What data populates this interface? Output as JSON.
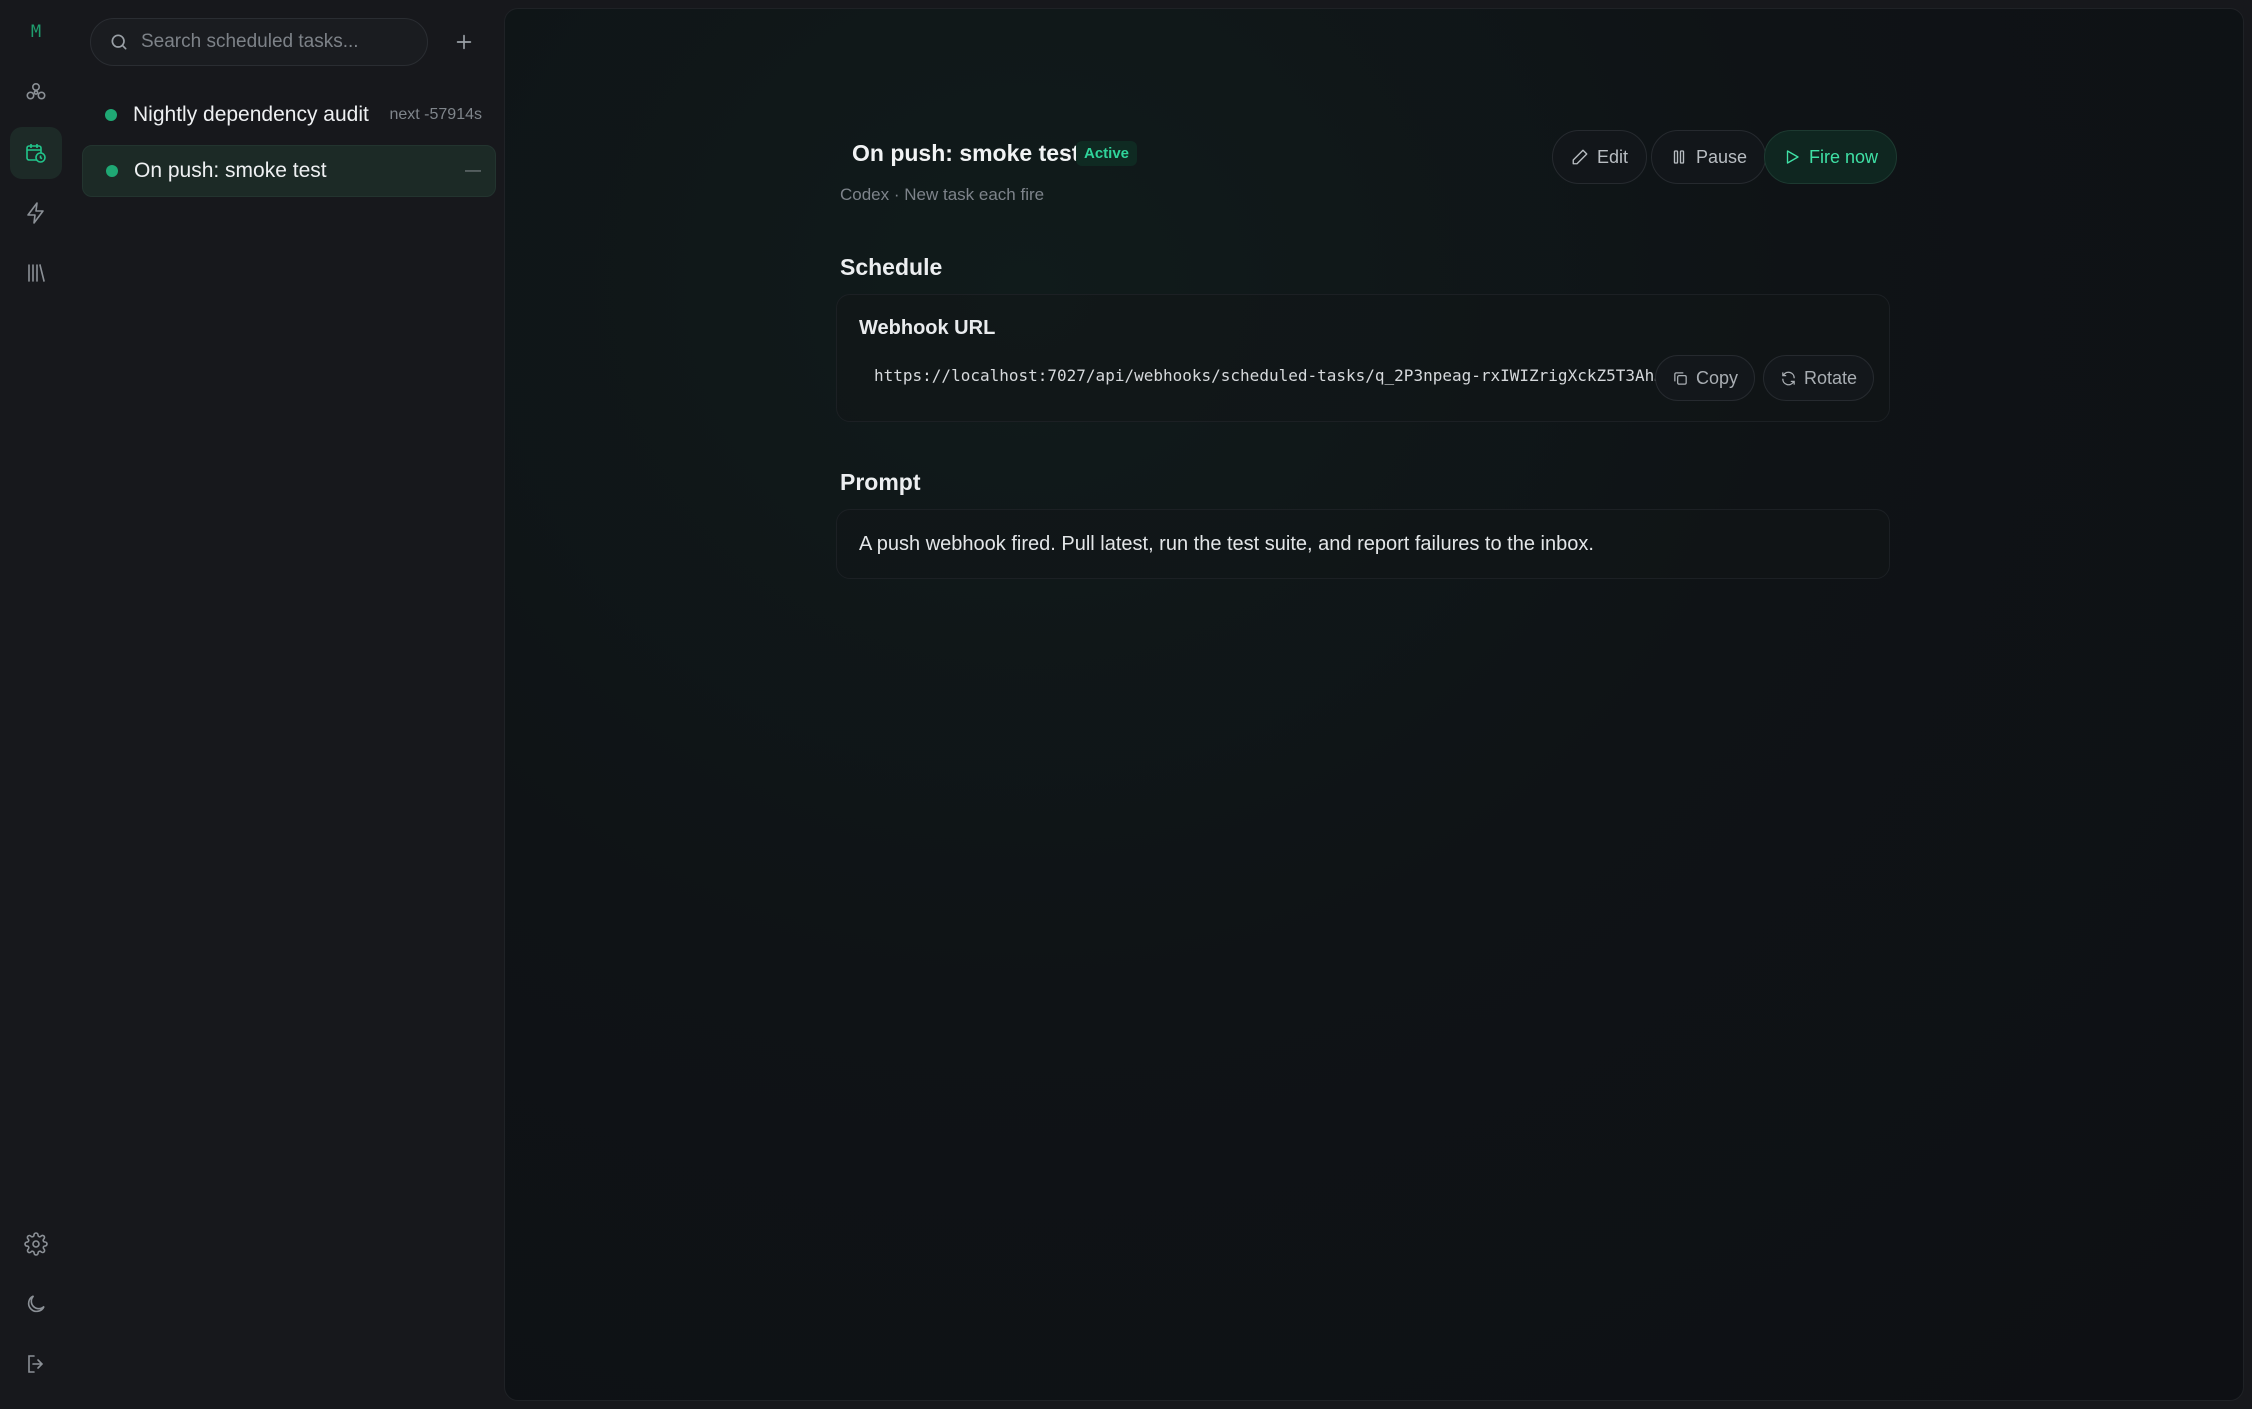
{
  "rail": {
    "logo": "M",
    "items": [
      {
        "icon": "agents-icon",
        "label": "Agents"
      },
      {
        "icon": "calendar-clock-icon",
        "label": "Scheduled tasks",
        "active": true
      },
      {
        "icon": "bolt-icon",
        "label": "Triggers"
      },
      {
        "icon": "library-icon",
        "label": "Library"
      }
    ],
    "bottom": [
      {
        "icon": "gear-icon"
      },
      {
        "icon": "moon-icon"
      },
      {
        "icon": "logout-icon"
      }
    ]
  },
  "sidebar": {
    "search_placeholder": "Search scheduled tasks...",
    "tasks": [
      {
        "name": "Nightly dependency audit",
        "meta": "next -57914s",
        "status": "active"
      },
      {
        "name": "On push: smoke test",
        "meta": "—",
        "status": "active",
        "selected": true
      }
    ]
  },
  "detail": {
    "title": "On push: smoke test",
    "status_badge": "Active",
    "subtitle": "Codex · New task each fire",
    "actions": {
      "edit": "Edit",
      "pause": "Pause",
      "fire": "Fire now"
    },
    "schedule": {
      "heading": "Schedule",
      "webhook_label": "Webhook URL",
      "webhook_url": "https://localhost:7027/api/webhooks/scheduled-tasks/q_2P3npeag-rxIWIZrigXckZ5T3Ah…",
      "copy": "Copy",
      "rotate": "Rotate"
    },
    "prompt": {
      "heading": "Prompt",
      "text": "A push webhook fired. Pull latest, run the test suite, and report failures to the inbox."
    }
  },
  "colors": {
    "accent": "#22c58b",
    "background": "#17181c",
    "main": "#0e1014"
  }
}
